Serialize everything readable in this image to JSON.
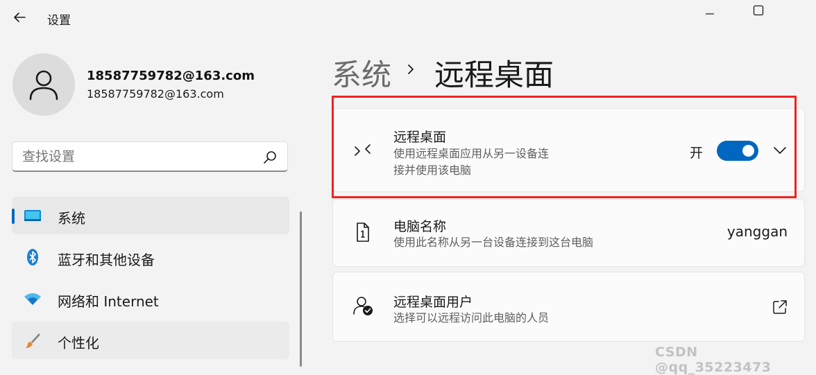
{
  "window": {
    "title": "设置",
    "controls": [
      "minimize",
      "maximize"
    ]
  },
  "account": {
    "name": "18587759782@163.com",
    "email": "18587759782@163.com"
  },
  "search": {
    "placeholder": "查找设置"
  },
  "sidebar": {
    "items": [
      {
        "label": "系统",
        "icon": "system-display-icon",
        "active": true
      },
      {
        "label": "蓝牙和其他设备",
        "icon": "bluetooth-icon",
        "active": false
      },
      {
        "label": "网络和 Internet",
        "icon": "wifi-icon",
        "active": false
      },
      {
        "label": "个性化",
        "icon": "brush-icon",
        "active": false
      }
    ]
  },
  "breadcrumb": {
    "parent": "系统",
    "current": "远程桌面"
  },
  "cards": {
    "remote_desktop": {
      "title": "远程桌面",
      "description_line1": "使用远程桌面应用从另一设备连",
      "description_line2": "接并使用该电脑",
      "toggle_label": "开",
      "toggle_on": true
    },
    "pc_name": {
      "title": "电脑名称",
      "description": "使用此名称从另一台设备连接到这台电脑",
      "value": "yanggan"
    },
    "remote_users": {
      "title": "远程桌面用户",
      "description": "选择可以远程访问此电脑的人员"
    }
  },
  "watermark": "CSDN @qq_35223473",
  "colors": {
    "accent": "#0067c0",
    "highlight": "#ee2222",
    "background": "#f3f3f3"
  }
}
